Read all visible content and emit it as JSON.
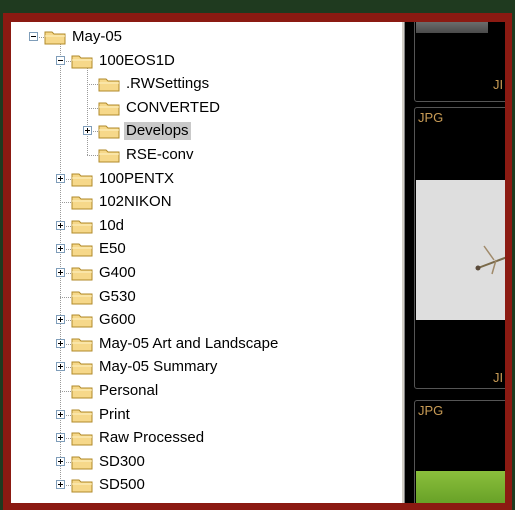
{
  "tree": {
    "items": [
      {
        "label": "May-05",
        "expander": "minus"
      },
      {
        "label": "100EOS1D",
        "expander": "minus"
      },
      {
        "label": ".RWSettings",
        "expander": "none"
      },
      {
        "label": "CONVERTED",
        "expander": "none"
      },
      {
        "label": "Develops",
        "expander": "plus",
        "selected": true
      },
      {
        "label": "RSE-conv",
        "expander": "none"
      },
      {
        "label": "100PENTX",
        "expander": "plus"
      },
      {
        "label": "102NIKON",
        "expander": "none"
      },
      {
        "label": "10d",
        "expander": "plus"
      },
      {
        "label": "E50",
        "expander": "plus"
      },
      {
        "label": "G400",
        "expander": "plus"
      },
      {
        "label": "G530",
        "expander": "none"
      },
      {
        "label": "G600",
        "expander": "plus"
      },
      {
        "label": "May-05 Art and Landscape",
        "expander": "plus"
      },
      {
        "label": "May-05 Summary",
        "expander": "plus"
      },
      {
        "label": "Personal",
        "expander": "none"
      },
      {
        "label": "Print",
        "expander": "plus"
      },
      {
        "label": "Raw Processed",
        "expander": "plus"
      },
      {
        "label": "SD300",
        "expander": "plus"
      },
      {
        "label": "SD500",
        "expander": "plus"
      }
    ]
  },
  "thumbnails": [
    {
      "tag": "",
      "caption": "JI"
    },
    {
      "tag": "JPG",
      "caption": "JI"
    },
    {
      "tag": "JPG",
      "caption": ""
    }
  ],
  "colors": {
    "frame": "#8b1a12",
    "outer_background": "#1f3a1f",
    "selection": "#c9c9c9",
    "thumb_tag": "#c89b55",
    "folder_fill": "#f6d88a"
  }
}
